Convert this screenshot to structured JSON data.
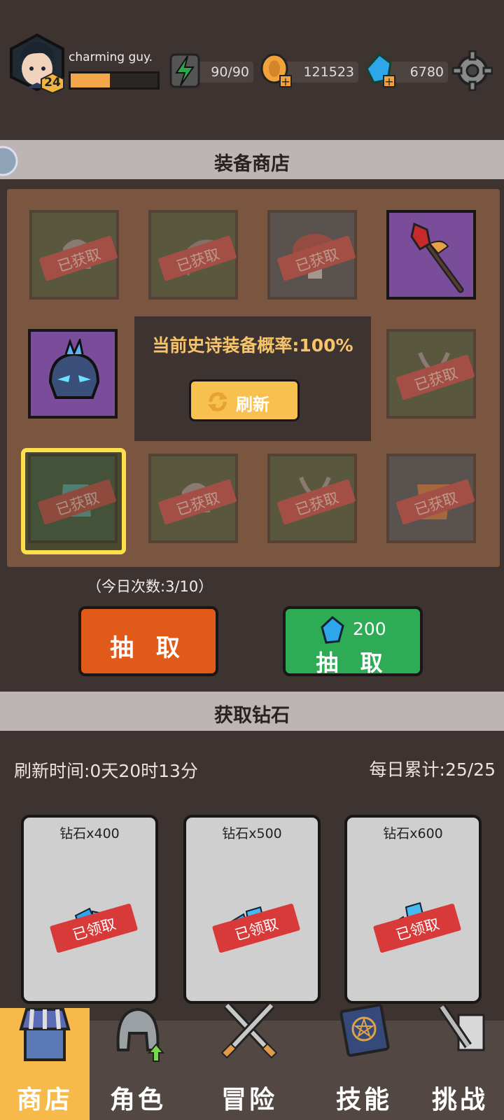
{
  "player": {
    "name": "charming guy.",
    "level": "24",
    "xp_fraction": 0.45
  },
  "resources": {
    "energy": "90/90",
    "gold": "121523",
    "gems": "6780"
  },
  "equipment_shop": {
    "title": "装备商店",
    "epic_rate": "当前史诗装备概率:100%",
    "refresh_label": "刷新",
    "obtained_label": "已获取",
    "daily_count": "（今日次数:3/10）",
    "draw_label": "抽 取",
    "gem_draw_cost": "200",
    "gem_draw_label": "抽 取"
  },
  "gem_shop": {
    "title": "获取钻石",
    "refresh_time": "刷新时间:0天20时13分",
    "daily_total": "每日累计:25/25",
    "claimed_label": "已领取",
    "cards": [
      {
        "name": "钻石x400"
      },
      {
        "name": "钻石x500"
      },
      {
        "name": "钻石x600"
      }
    ]
  },
  "nav": [
    {
      "label": "商店",
      "icon": "shop-icon",
      "active": true
    },
    {
      "label": "角色",
      "icon": "helmet-icon"
    },
    {
      "label": "冒险",
      "icon": "crossed-swords-icon"
    },
    {
      "label": "技能",
      "icon": "spellbook-icon"
    },
    {
      "label": "挑战",
      "icon": "sword-scroll-icon"
    }
  ],
  "colors": {
    "background": "#3d3331",
    "accent_orange": "#e25a1a",
    "accent_green": "#2dab55",
    "gold": "#f8c04f"
  }
}
